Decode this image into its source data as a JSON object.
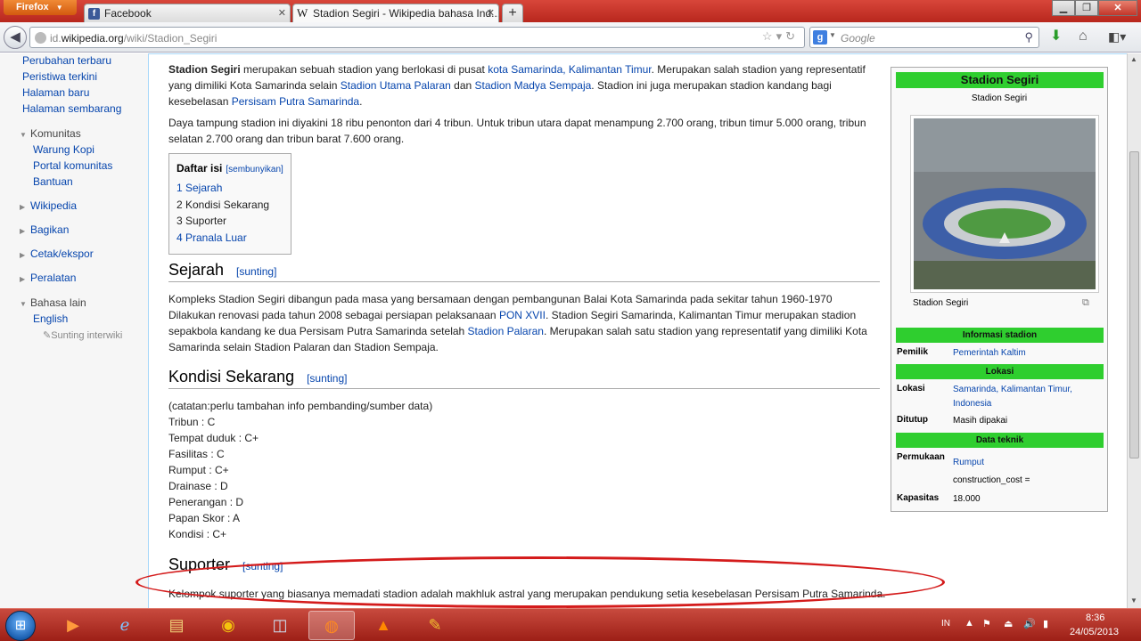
{
  "browser": {
    "menu_button": "Firefox",
    "tabs": [
      {
        "label": "Facebook"
      },
      {
        "label": "Stadion Segiri - Wikipedia bahasa Ind..."
      }
    ],
    "url_prefix": "id.",
    "url_domain": "wikipedia.org",
    "url_path": "/wiki/Stadion_Segiri",
    "search_placeholder": "Google"
  },
  "sidebar": {
    "links": [
      "Perubahan terbaru",
      "Peristiwa terkini",
      "Halaman baru",
      "Halaman sembarang"
    ],
    "community": {
      "heading": "Komunitas",
      "items": [
        "Warung Kopi",
        "Portal komunitas",
        "Bantuan"
      ]
    },
    "sections": [
      "Wikipedia",
      "Bagikan",
      "Cetak/ekspor",
      "Peralatan"
    ],
    "languages": {
      "heading": "Bahasa lain",
      "items": [
        "English"
      ],
      "edit": "Sunting interwiki"
    }
  },
  "article": {
    "intro": {
      "title_bold": "Stadion Segiri",
      "t1": " merupakan sebuah stadion yang berlokasi di pusat ",
      "l1": "kota Samarinda, Kalimantan Timur",
      "t2": ". Merupakan salah stadion yang representatif yang dimiliki Kota Samarinda selain ",
      "l2": "Stadion Utama Palaran",
      "t3": " dan ",
      "l3": "Stadion Madya Sempaja",
      "t4": ". Stadion ini juga merupakan stadion kandang bagi kesebelasan ",
      "l4": "Persisam Putra Samarinda",
      "t5": "."
    },
    "capacity_text": "Daya tampung stadion ini diyakini 18 ribu penonton dari 4 tribun. Untuk tribun utara dapat menampung 2.700 orang, tribun timur 5.000 orang, tribun selatan 2.700 orang dan tribun barat 7.600 orang.",
    "toc": {
      "title": "Daftar isi",
      "hide": "[sembunyikan]",
      "items": [
        "1 Sejarah",
        "2 Kondisi Sekarang",
        "3 Suporter",
        "4 Pranala Luar"
      ]
    },
    "edit_label": "[sunting]",
    "sejarah": {
      "heading": "Sejarah",
      "t1": "Kompleks Stadion Segiri dibangun pada masa yang bersamaan dengan pembangunan Balai Kota Samarinda pada sekitar tahun 1960-1970 Dilakukan renovasi pada tahun 2008 sebagai persiapan pelaksanaan ",
      "l1": "PON XVII",
      "t2": ". Stadion Segiri Samarinda, Kalimantan Timur merupakan stadion sepakbola kandang ke dua Persisam Putra Samarinda setelah ",
      "l2": "Stadion Palaran",
      "t3": ". Merupakan salah satu stadion yang representatif yang dimiliki Kota Samarinda selain Stadion Palaran dan Stadion Sempaja."
    },
    "kondisi": {
      "heading": "Kondisi Sekarang",
      "lines": [
        "(catatan:perlu tambahan info pembanding/sumber data)",
        "Tribun : C",
        "Tempat duduk : C+",
        "Fasilitas : C",
        "Rumput : C+",
        "Drainase : D",
        "Penerangan : D",
        "Papan Skor : A",
        "Kondisi : C+"
      ]
    },
    "suporter": {
      "heading": "Suporter",
      "text": "Kelompok suporter yang biasanya memadati stadion adalah makhluk astral yang merupakan pendukung setia kesebelasan Persisam Putra Samarinda."
    }
  },
  "infobox": {
    "title": "Stadion Segiri",
    "subtitle": "Stadion Segiri",
    "caption": "Stadion Segiri",
    "info_heading": "Informasi stadion",
    "owner_label": "Pemilik",
    "owner_value": "Pemerintah Kaltim",
    "location_heading": "Lokasi",
    "location_label": "Lokasi",
    "location_value": "Samarinda, Kalimantan Timur, Indonesia",
    "closed_label": "Ditutup",
    "closed_value": "Masih dipakai",
    "tech_heading": "Data teknik",
    "surface_label": "Permukaan",
    "surface_value": "Rumput",
    "construction_cost": "construction_cost =",
    "capacity_label": "Kapasitas",
    "capacity_value": "18.000"
  },
  "taskbar": {
    "language": "IN",
    "time": "8:36",
    "date": "24/05/2013"
  },
  "colors": {
    "infobox_band": "#2fce2f",
    "link": "#0645ad",
    "annotation": "#d41b1b",
    "titlebar": "#c0392b"
  }
}
